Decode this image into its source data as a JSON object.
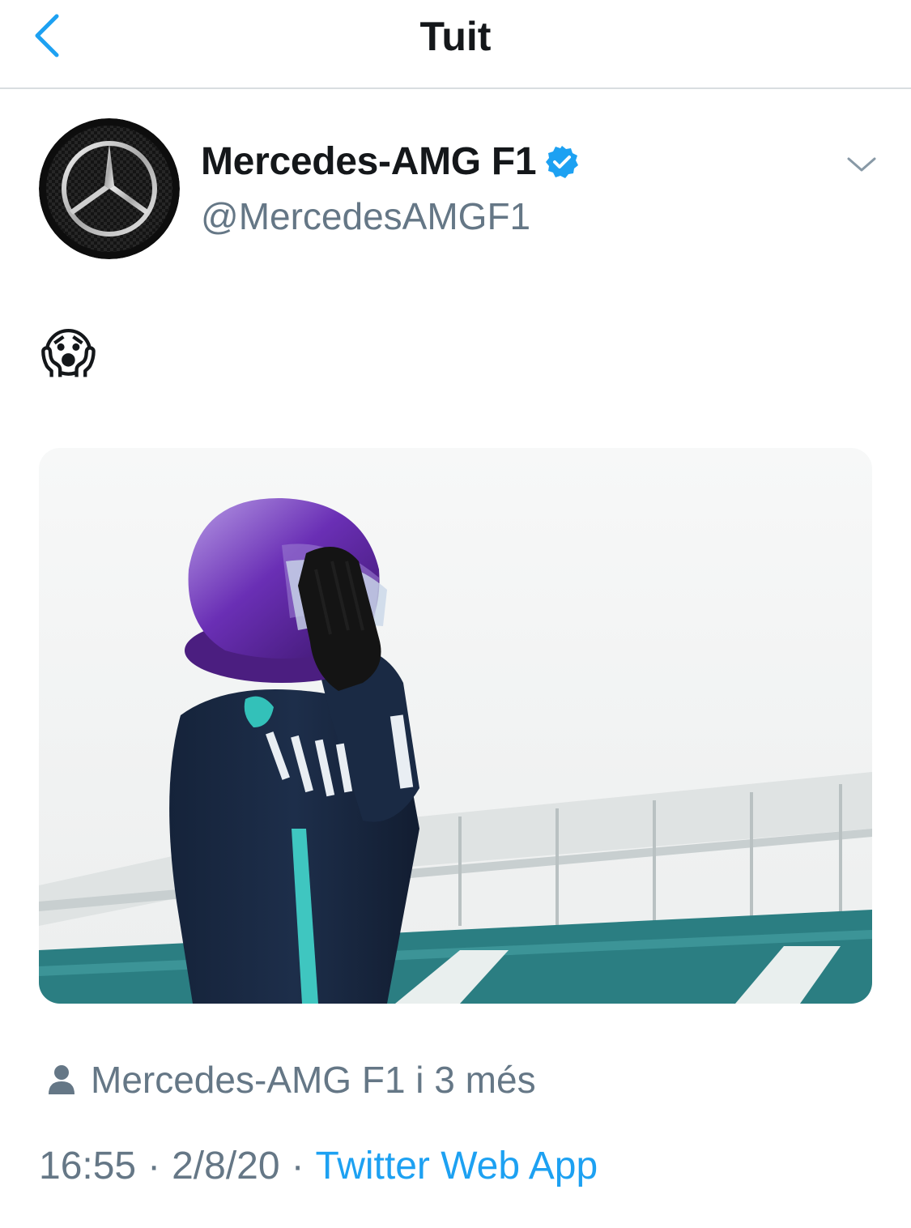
{
  "header": {
    "title": "Tuit",
    "back_icon": "chevron-left-icon",
    "accent": "#1da1f2"
  },
  "tweet": {
    "author_name": "Mercedes-AMG F1",
    "author_handle": "@MercedesAMGF1",
    "verified_icon": "verified-badge-icon",
    "menu_icon": "chevron-down-icon",
    "text": "😱",
    "media_alt_icon": "photo-driver-helmet",
    "tagged_line": "Mercedes-AMG F1 i 3 més",
    "time": "16:55",
    "date": "2/8/20",
    "separator": "·",
    "source": "Twitter Web App"
  },
  "colors": {
    "text_primary": "#14171a",
    "text_secondary": "#657786",
    "link": "#1da1f2",
    "divider": "#d9dde0"
  }
}
